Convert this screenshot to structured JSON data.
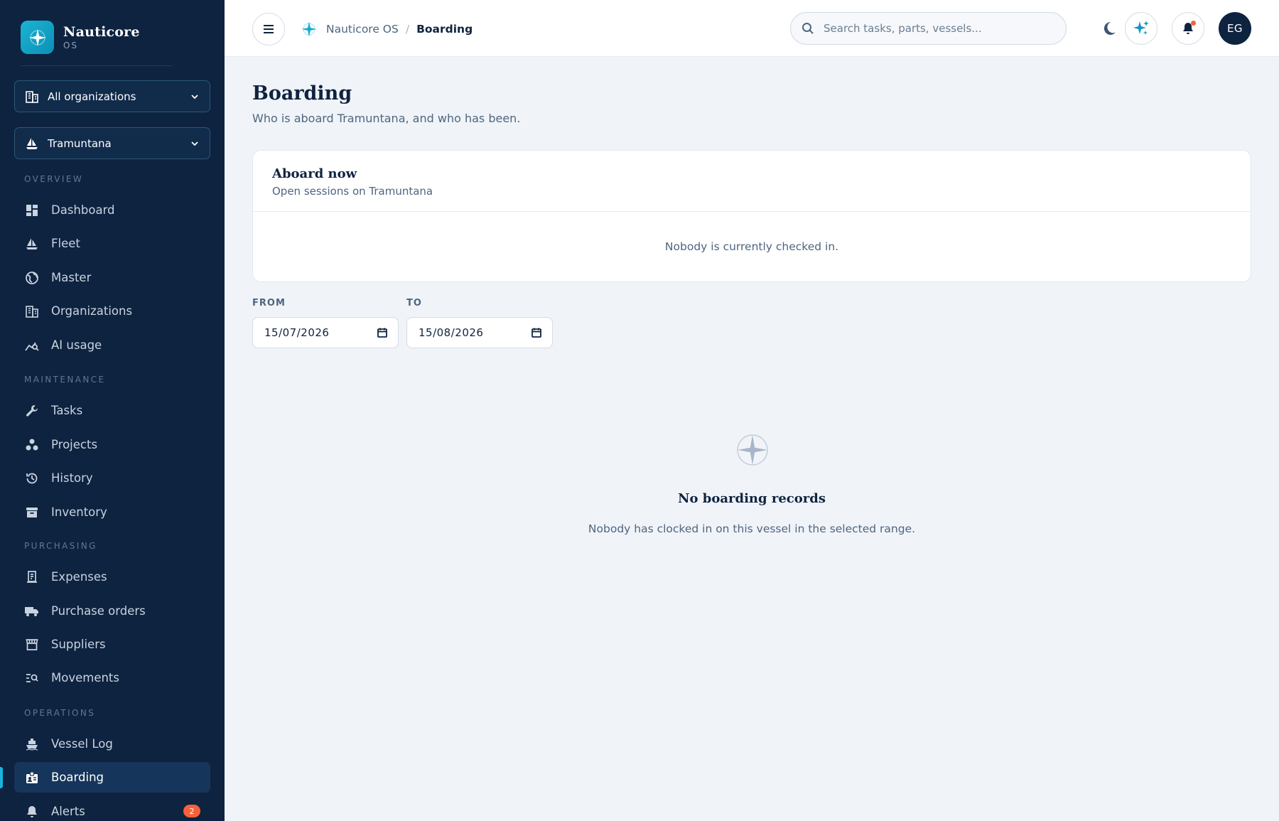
{
  "brand": {
    "name": "Nauticore",
    "sub": "OS"
  },
  "selectors": {
    "organization": "All organizations",
    "vessel": "Tramuntana"
  },
  "sidebar": {
    "sections": {
      "overview": "OVERVIEW",
      "maintenance": "MAINTENANCE",
      "purchasing": "PURCHASING",
      "operations": "OPERATIONS"
    },
    "items": {
      "dashboard": "Dashboard",
      "fleet": "Fleet",
      "master": "Master",
      "organizations": "Organizations",
      "ai_usage": "AI usage",
      "tasks": "Tasks",
      "projects": "Projects",
      "history": "History",
      "inventory": "Inventory",
      "expenses": "Expenses",
      "purchase_orders": "Purchase orders",
      "suppliers": "Suppliers",
      "movements": "Movements",
      "vessel_log": "Vessel Log",
      "boarding": "Boarding",
      "alerts": "Alerts"
    },
    "alerts_badge": "2",
    "active_item": "boarding"
  },
  "breadcrumb": {
    "root": "Nauticore OS",
    "separator": "/",
    "current": "Boarding"
  },
  "search": {
    "placeholder": "Search tasks, parts, vessels..."
  },
  "user": {
    "initials": "EG"
  },
  "page": {
    "title": "Boarding",
    "subtitle": "Who is aboard Tramuntana, and who has been."
  },
  "aboard_card": {
    "title": "Aboard now",
    "subtitle": "Open sessions on Tramuntana",
    "empty": "Nobody is currently checked in."
  },
  "filters": {
    "from_label": "FROM",
    "from_value": "15/07/2026",
    "to_label": "TO",
    "to_value": "15/08/2026"
  },
  "empty_state": {
    "title": "No boarding records",
    "subtitle": "Nobody has clocked in on this vessel in the selected range."
  },
  "colors": {
    "sidebar_bg": "#0d2340",
    "accent": "#18b4e0",
    "badge": "#f4613a",
    "page_bg": "#f0f4f8"
  }
}
